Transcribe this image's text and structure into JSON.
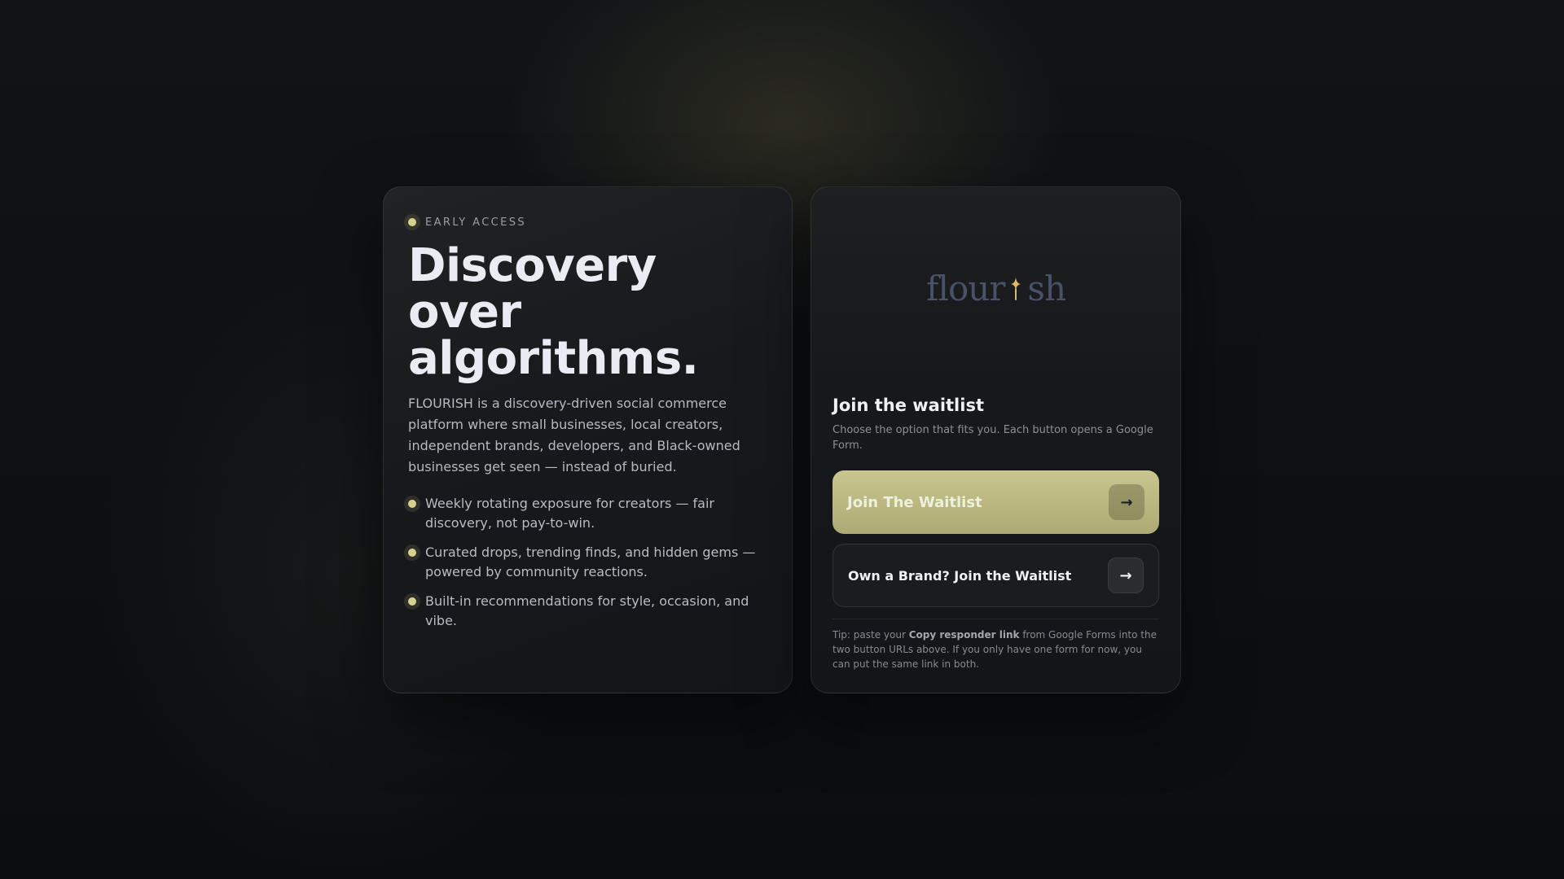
{
  "hero": {
    "eyebrow": "EARLY ACCESS",
    "headline_lines": [
      "Discovery",
      "over",
      "algorithms."
    ],
    "description": "FLOURISH is a discovery-driven social commerce platform where small businesses, local creators, independent brands, developers, and Black-owned businesses get seen — instead of buried.",
    "features": [
      "Weekly rotating exposure for creators — fair discovery, not pay-to-win.",
      "Curated drops, trending finds, and hidden gems — powered by community reactions.",
      "Built-in recommendations for style, occasion, and vibe."
    ]
  },
  "waitlist": {
    "logo_text_before": "flour",
    "logo_text_after": "sh",
    "logo_icon": "sparkle-i-icon",
    "title": "Join the waitlist",
    "subtitle": "Choose the option that fits you. Each button opens a Google Form.",
    "primary_button": {
      "label": "Join The Waitlist",
      "icon": "arrow-right-icon",
      "arrow": "→"
    },
    "secondary_button": {
      "label": "Own a Brand? Join the Waitlist",
      "icon": "arrow-right-icon",
      "arrow": "→"
    },
    "tip": {
      "prefix": "Tip: paste your ",
      "bold": "Copy responder link",
      "suffix": " from Google Forms into the two button URLs above. If you only have one form for now, you can put the same link in both."
    }
  },
  "colors": {
    "accent": "#d8d28f",
    "primary_button": "#bfbb84",
    "logo": "#4a5168",
    "logo_mark": "#e2b867"
  }
}
